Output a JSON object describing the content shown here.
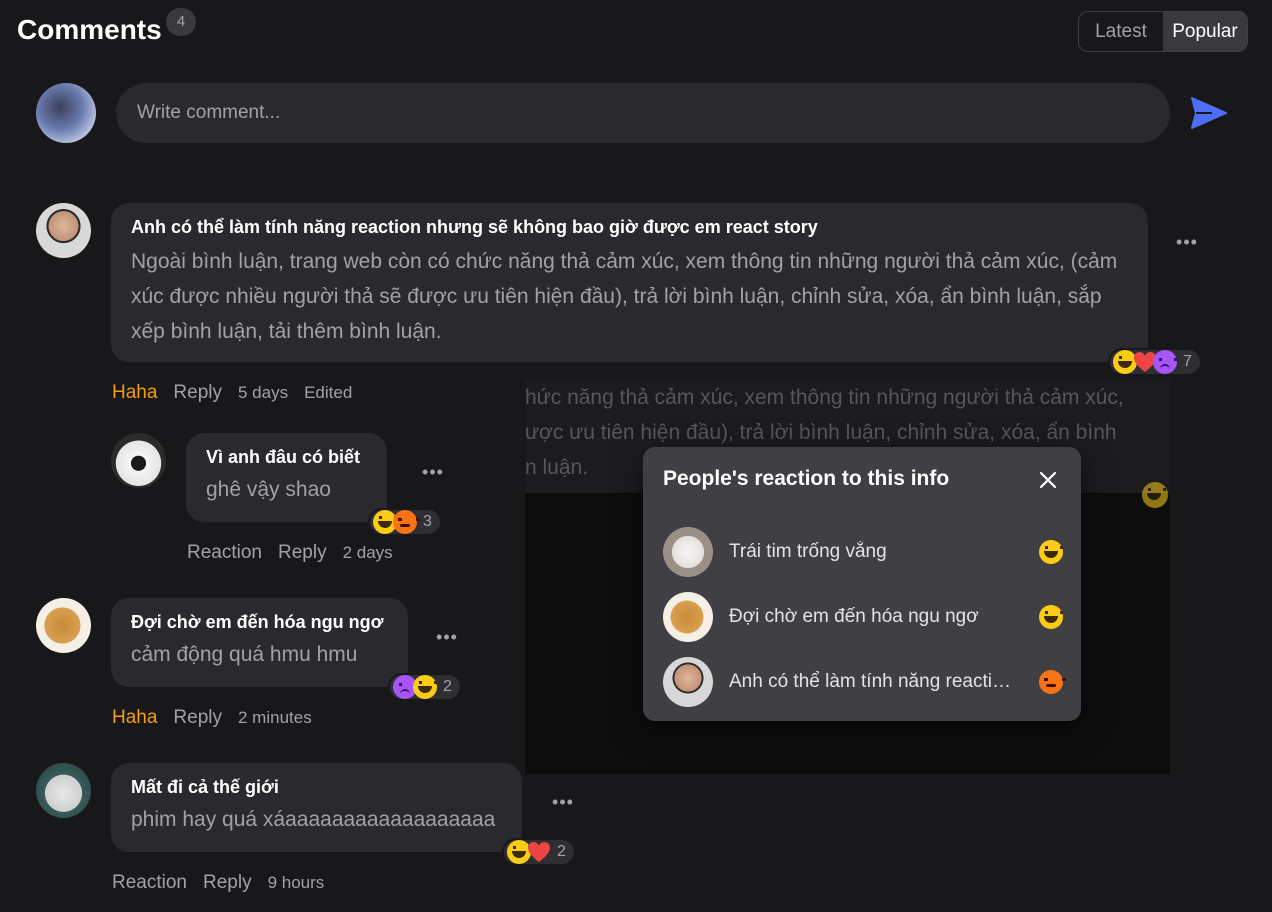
{
  "header": {
    "title": "Comments",
    "count": "4",
    "sort_options": [
      "Latest",
      "Popular"
    ],
    "active_sort": "Popular"
  },
  "composer": {
    "placeholder": "Write comment..."
  },
  "comments": [
    {
      "author": "Anh có thể làm tính năng reaction nhưng sẽ không bao giờ được em react story",
      "text": "Ngoài bình luận, trang web còn có chức năng thả cảm xúc, xem thông tin những người thả cảm xúc, (cảm xúc được nhiều người thả sẽ được ưu tiên hiện đầu), trả lời bình luận, chỉnh sửa, xóa, ẩn bình luận, sắp xếp bình luận, tải thêm bình luận.",
      "reactions": [
        "haha",
        "love",
        "sad"
      ],
      "reaction_count": "7",
      "my_reaction": "Haha",
      "reply_label": "Reply",
      "time": "5 days",
      "edited": "Edited"
    },
    {
      "author": "Vì anh đâu có biết",
      "text": "ghê vậy shao",
      "reactions": [
        "haha",
        "angry"
      ],
      "reaction_count": "3",
      "my_reaction": "Reaction",
      "reply_label": "Reply",
      "time": "2 days"
    },
    {
      "author": "Đợi chờ em đến hóa ngu ngơ",
      "text": "cảm động quá hmu hmu",
      "reactions": [
        "sad",
        "haha"
      ],
      "reaction_count": "2",
      "my_reaction": "Haha",
      "reply_label": "Reply",
      "time": "2 minutes"
    },
    {
      "author": "Mất đi cả thế giới",
      "text": "phim hay quá xáaaaaaaaaaaaaaaaaaa",
      "reactions": [
        "haha",
        "love"
      ],
      "reaction_count": "2",
      "my_reaction": "Reaction",
      "reply_label": "Reply",
      "time": "9 hours"
    }
  ],
  "background_peek": {
    "lines": [
      "hức năng thả cảm xúc, xem thông tin những người thả cảm xúc,",
      "ược ưu tiên hiện đầu), trả lời bình luận, chỉnh sửa, xóa, ẩn bình",
      "n luận."
    ]
  },
  "modal": {
    "title": "People's reaction to this info",
    "rows": [
      {
        "name": "Trái tim trống vắng",
        "reaction": "haha"
      },
      {
        "name": "Đợi chờ em đến hóa ngu ngơ",
        "reaction": "haha"
      },
      {
        "name": "Anh có thể làm tính năng reaction nhưng sẽ không bao giờ được em react story",
        "reaction": "angry"
      }
    ]
  },
  "colors": {
    "background": "#18181b",
    "bubble": "#2a2a2e",
    "accent_haha": "#f59e0b",
    "send": "#4f6ef7",
    "modal": "#3f3f44"
  }
}
